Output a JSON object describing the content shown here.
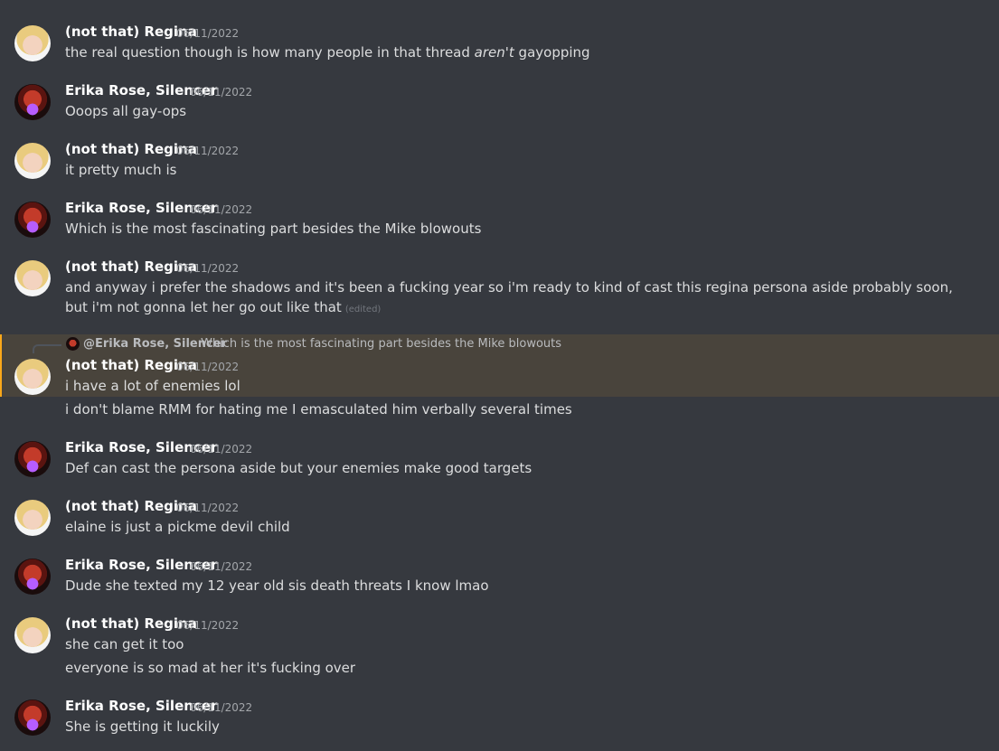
{
  "messages": [
    {
      "author": "(not that) Regina",
      "time": "06/11/2022",
      "lines": [
        "the real question though is how many people in that thread ",
        "aren't",
        " gayopping"
      ]
    },
    {
      "author": "Erika Rose, Silencer",
      "time": "06/11/2022",
      "lines": [
        "Ooops all gay-ops"
      ]
    },
    {
      "author": "(not that) Regina",
      "time": "06/11/2022",
      "lines": [
        "it pretty much is"
      ]
    },
    {
      "author": "Erika Rose, Silencer",
      "time": "06/11/2022",
      "lines": [
        "Which is the most fascinating part besides the Mike blowouts"
      ]
    },
    {
      "author": "(not that) Regina",
      "time": "06/11/2022",
      "lines": [
        "and anyway i prefer the shadows and it's been a fucking year so i'm ready to kind of cast this regina persona aside probably soon, but i'm not gonna let her go out like that"
      ],
      "edited": "(edited)"
    },
    {
      "author": "(not that) Regina",
      "time": "06/11/2022",
      "lines": [
        "i have a lot of enemies lol",
        "i don't blame RMM for hating me I emasculated him verbally several times"
      ],
      "reply": {
        "name": "@Erika Rose, Silencer",
        "text": "Which is the most fascinating part besides the Mike blowouts"
      }
    },
    {
      "author": "Erika Rose, Silencer",
      "time": "06/11/2022",
      "lines": [
        "Def can cast the persona aside but your enemies make good targets"
      ]
    },
    {
      "author": "(not that) Regina",
      "time": "06/11/2022",
      "lines": [
        "elaine is just a pickme devil child"
      ]
    },
    {
      "author": "Erika Rose, Silencer",
      "time": "06/11/2022",
      "lines": [
        "Dude she texted my 12 year old sis death threats I know lmao"
      ]
    },
    {
      "author": "(not that) Regina",
      "time": "06/11/2022",
      "lines": [
        "she can get it too",
        "everyone is so mad at her it's fucking over"
      ]
    },
    {
      "author": "Erika Rose, Silencer",
      "time": "06/11/2022",
      "lines": [
        "She is getting it luckily"
      ]
    }
  ],
  "colors": {
    "background": "#36393f",
    "highlight": "#49443c",
    "highlight_bar": "#faa81a",
    "name": "#ffffff",
    "text": "#dcddde",
    "timestamp": "#a3a6aa"
  }
}
